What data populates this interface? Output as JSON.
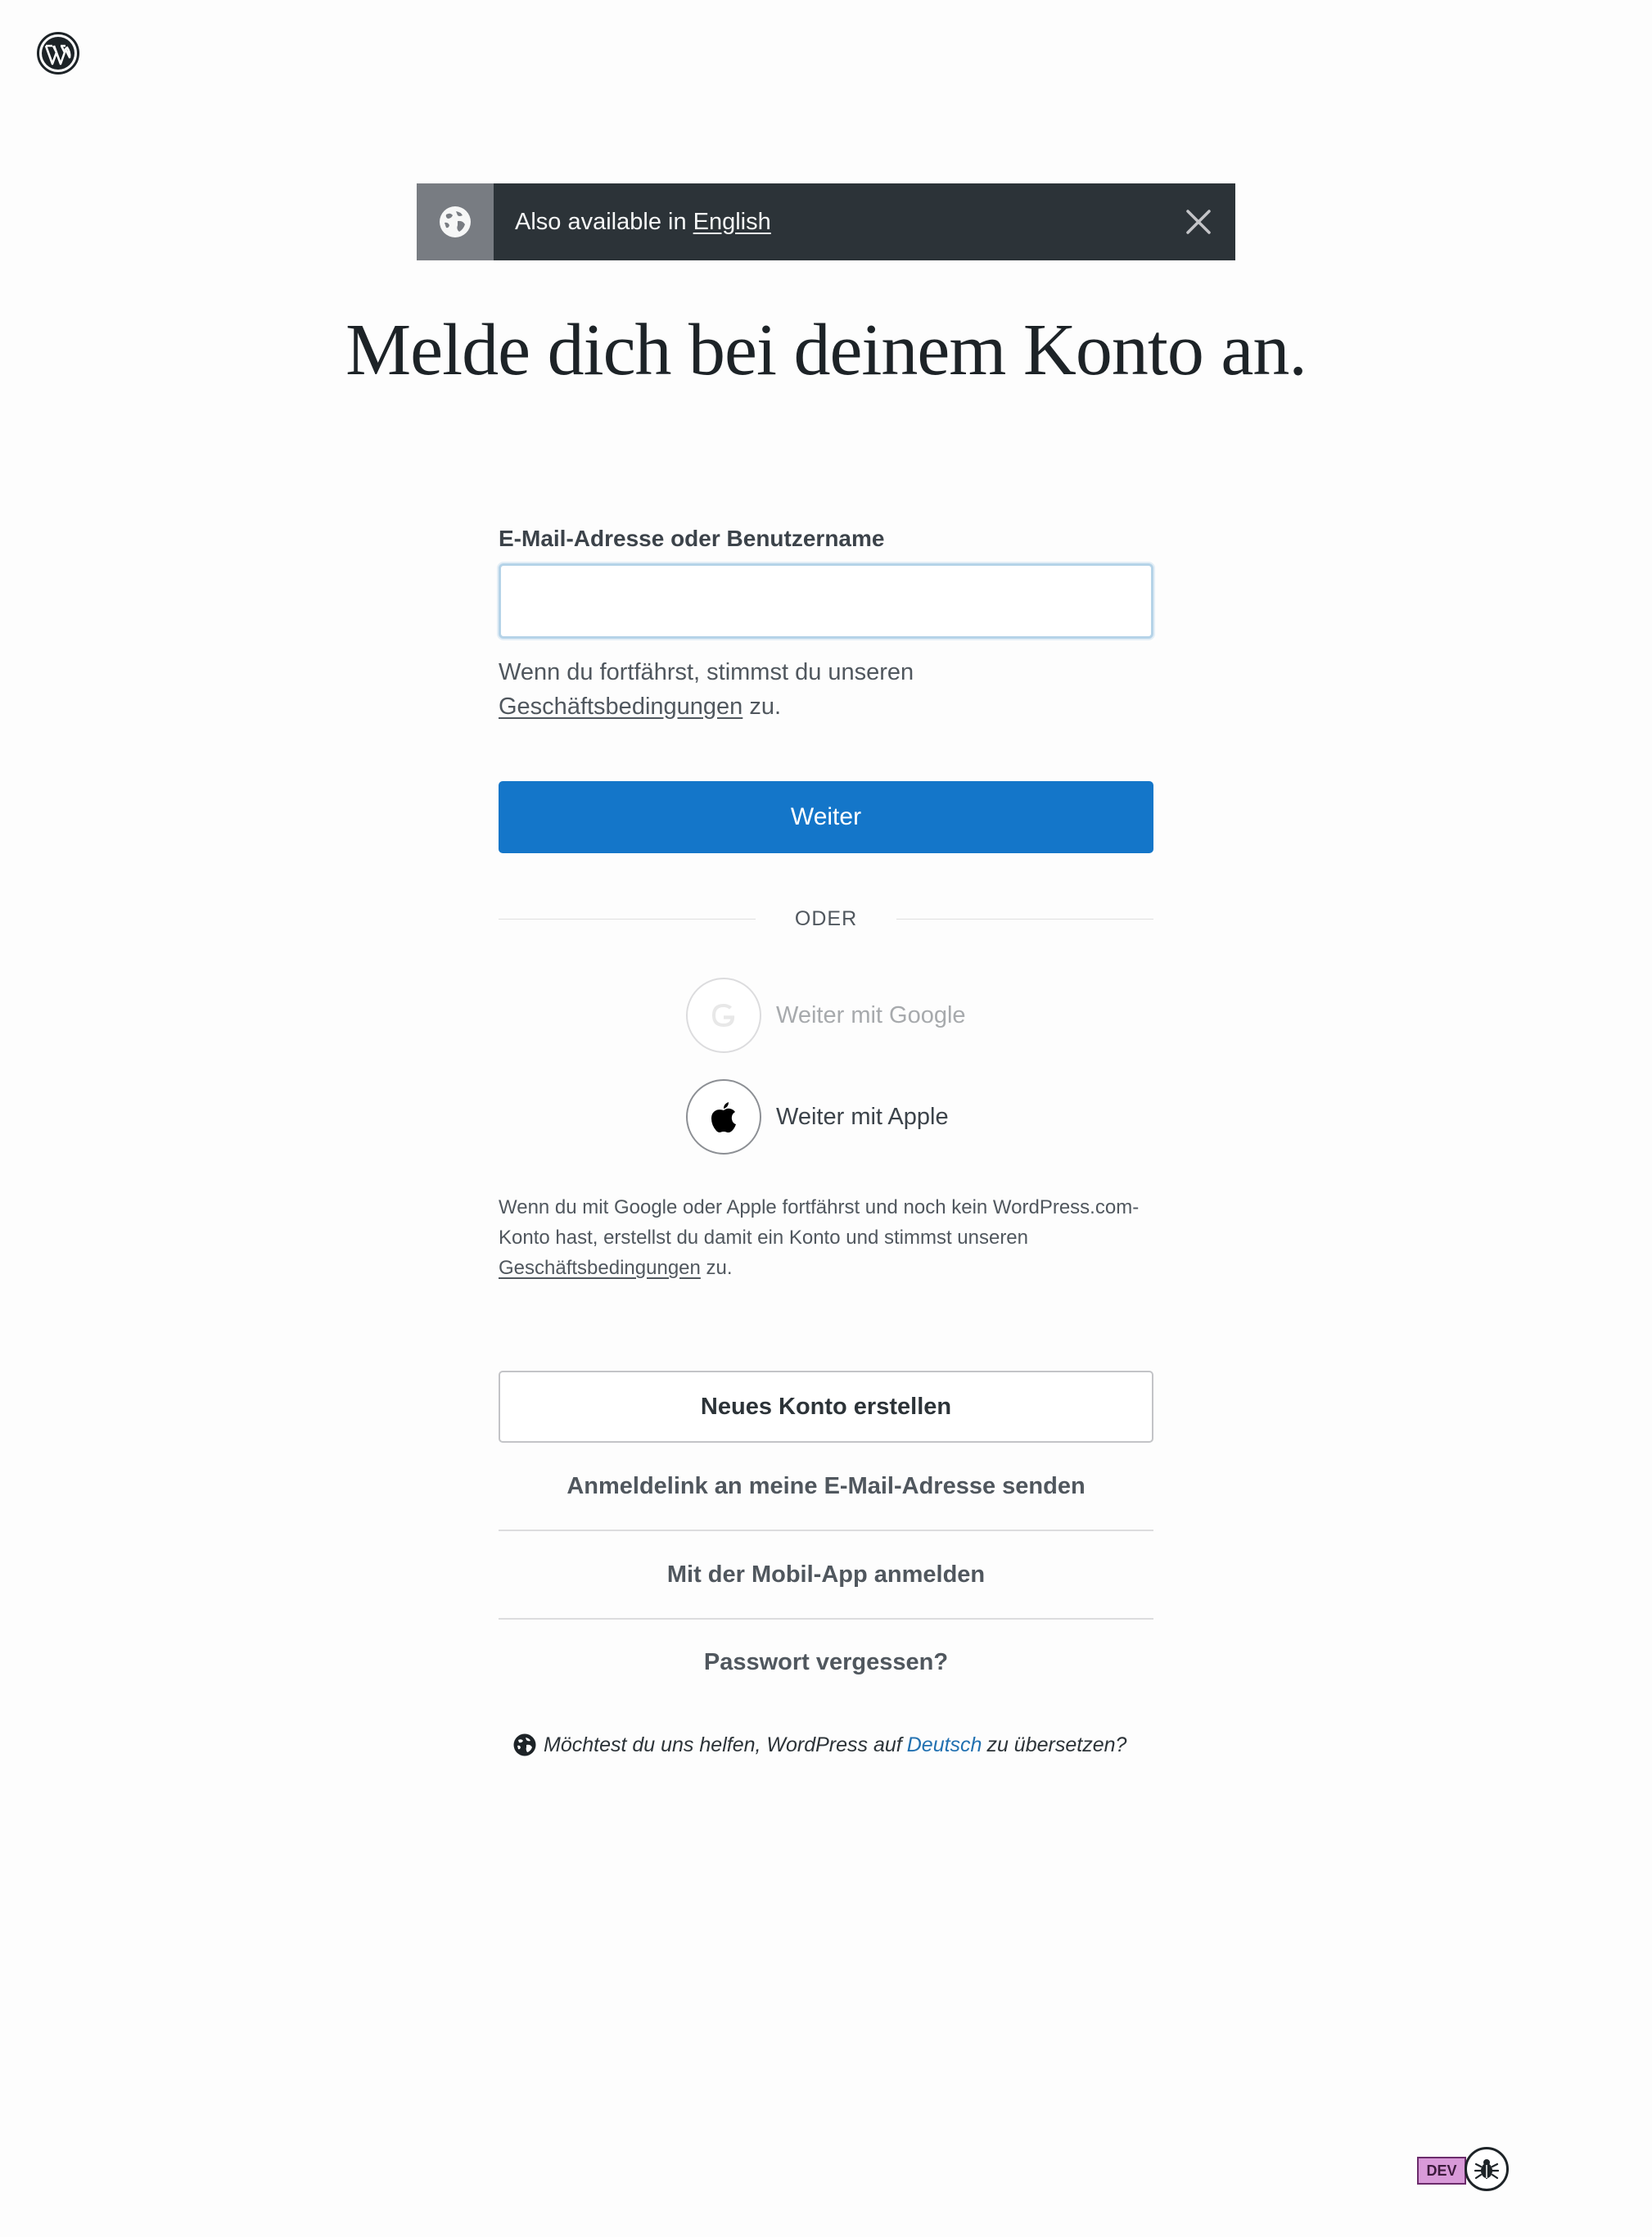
{
  "banner": {
    "prefix": "Also available in",
    "language_link": "English"
  },
  "heading": "Melde dich bei deinem Konto an.",
  "form": {
    "email_label": "E-Mail-Adresse oder Benutzername",
    "email_value": "",
    "tos_prefix": "Wenn du fortfährst, stimmst du unseren",
    "tos_link": "Geschäftsbedingungen",
    "tos_suffix": "zu.",
    "submit_label": "Weiter"
  },
  "divider_label": "ODER",
  "social": {
    "google_label": "Weiter mit Google",
    "apple_label": "Weiter mit Apple",
    "note_text": "Wenn du mit Google oder Apple fortfährst und noch kein WordPress.com-Konto hast, erstellst du damit ein Konto und stimmst unseren",
    "note_link": "Geschäftsbedingungen",
    "note_suffix": "zu."
  },
  "actions": {
    "create_account": "Neues Konto erstellen",
    "magic_link": "Anmeldelink an meine E-Mail-Adresse senden",
    "mobile_app": "Mit der Mobil-App anmelden",
    "forgot_password": "Passwort vergessen?"
  },
  "translate": {
    "prefix": "Möchtest du uns helfen, WordPress auf",
    "language": "Deutsch",
    "suffix": "zu übersetzen?"
  },
  "dev_badge": "DEV",
  "icons": {
    "logo": "wordpress-logo-icon",
    "globe": "globe-icon",
    "close": "close-icon",
    "google": "google-icon",
    "apple": "apple-icon",
    "bug": "bug-icon"
  },
  "colors": {
    "primary": "#1476c9",
    "banner_bg": "#2c3338",
    "link_blue": "#2271b1",
    "dev_badge": "#d89ad8"
  }
}
